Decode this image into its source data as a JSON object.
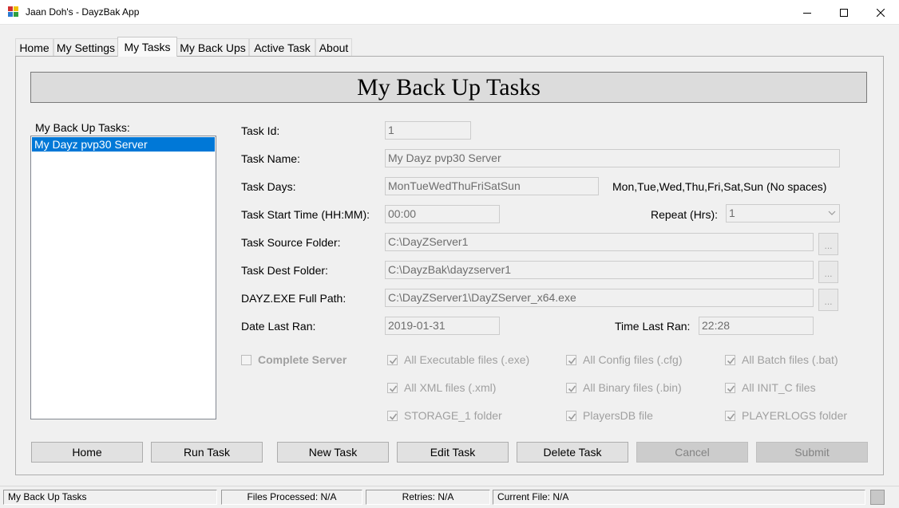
{
  "window": {
    "title": "Jaan Doh's - DayzBak App",
    "icon": "app-grid-icon",
    "controls": [
      "minimize-icon",
      "maximize-icon",
      "close-icon"
    ]
  },
  "tabs": [
    {
      "label": "Home",
      "active": false
    },
    {
      "label": "My Settings",
      "active": false
    },
    {
      "label": "My Tasks",
      "active": true
    },
    {
      "label": "My Back Ups",
      "active": false
    },
    {
      "label": "Active Task",
      "active": false
    },
    {
      "label": "About",
      "active": false
    }
  ],
  "page": {
    "title": "My Back Up Tasks"
  },
  "task_list": {
    "label": "My Back Up Tasks:",
    "items": [
      {
        "label": "My Dayz pvp30 Server",
        "selected": true
      }
    ]
  },
  "form": {
    "task_id": {
      "label": "Task Id:",
      "value": "1"
    },
    "task_name": {
      "label": "Task Name:",
      "value": "My Dayz pvp30 Server"
    },
    "task_days": {
      "label": "Task Days:",
      "value": "MonTueWedThuFriSatSun",
      "hint": "Mon,Tue,Wed,Thu,Fri,Sat,Sun (No spaces)"
    },
    "start_time": {
      "label": "Task Start Time (HH:MM):",
      "value": "00:00"
    },
    "repeat": {
      "label": "Repeat (Hrs):",
      "value": "1"
    },
    "source_folder": {
      "label": "Task Source Folder:",
      "value": "C:\\DayZServer1",
      "browse": "..."
    },
    "dest_folder": {
      "label": "Task Dest Folder:",
      "value": "C:\\DayzBak\\dayzserver1",
      "browse": "..."
    },
    "exe_path": {
      "label": "DAYZ.EXE Full Path:",
      "value": "C:\\DayZServer1\\DayZServer_x64.exe",
      "browse": "..."
    },
    "date_last_ran": {
      "label": "Date Last Ran:",
      "value": "2019-01-31"
    },
    "time_last_ran": {
      "label": "Time Last Ran:",
      "value": "22:28"
    }
  },
  "options": {
    "complete_server": {
      "label": "Complete Server",
      "checked": false
    },
    "exe_files": {
      "label": "All Executable files (.exe)",
      "checked": true
    },
    "cfg_files": {
      "label": "All Config files (.cfg)",
      "checked": true
    },
    "bat_files": {
      "label": "All Batch files (.bat)",
      "checked": true
    },
    "xml_files": {
      "label": "All XML files (.xml)",
      "checked": true
    },
    "bin_files": {
      "label": "All Binary  files (.bin)",
      "checked": true
    },
    "init_c_files": {
      "label": "All INIT_C files",
      "checked": true
    },
    "storage_folder": {
      "label": "STORAGE_1 folder",
      "checked": true
    },
    "playersdb_file": {
      "label": "PlayersDB file",
      "checked": true
    },
    "playerlogs_folder": {
      "label": "PLAYERLOGS folder",
      "checked": true
    }
  },
  "buttons": {
    "home": {
      "label": "Home",
      "enabled": true
    },
    "run_task": {
      "label": "Run Task",
      "enabled": true
    },
    "new_task": {
      "label": "New Task",
      "enabled": true
    },
    "edit_task": {
      "label": "Edit Task",
      "enabled": true
    },
    "delete_task": {
      "label": "Delete Task",
      "enabled": true
    },
    "cancel": {
      "label": "Cancel",
      "enabled": false
    },
    "submit": {
      "label": "Submit",
      "enabled": false
    }
  },
  "status_bar": {
    "status": "My Back Up Tasks",
    "files_processed": "Files Processed: N/A",
    "retries": "Retries: N/A",
    "current_file": "Current File: N/A"
  },
  "colors": {
    "selection": "#0078d7",
    "disabled_text": "#a0a0a0",
    "title_bar": "#ffffff"
  }
}
